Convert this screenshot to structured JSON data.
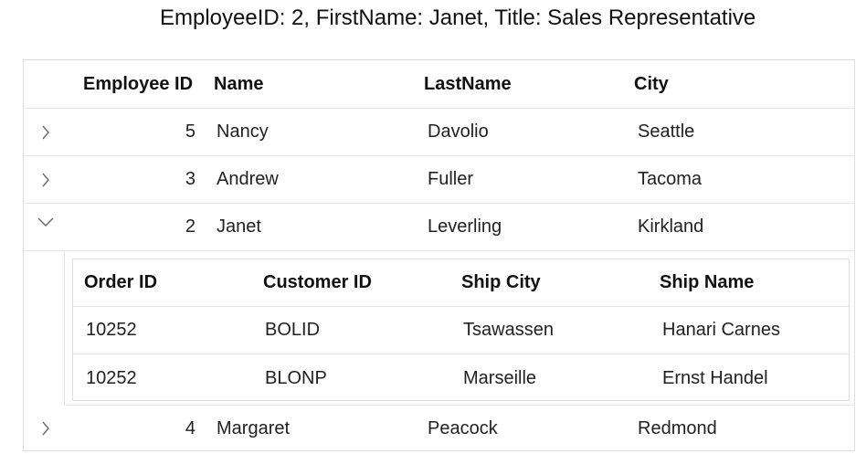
{
  "header": {
    "selected_text": "EmployeeID: 2, FirstName: Janet, Title: Sales Representative"
  },
  "grid": {
    "columns": [
      "Employee ID",
      "Name",
      "LastName",
      "City"
    ],
    "rows": [
      {
        "employee_id": "5",
        "name": "Nancy",
        "last_name": "Davolio",
        "city": "Seattle",
        "expanded": false
      },
      {
        "employee_id": "3",
        "name": "Andrew",
        "last_name": "Fuller",
        "city": "Tacoma",
        "expanded": false
      },
      {
        "employee_id": "2",
        "name": "Janet",
        "last_name": "Leverling",
        "city": "Kirkland",
        "expanded": true
      },
      {
        "employee_id": "4",
        "name": "Margaret",
        "last_name": "Peacock",
        "city": "Redmond",
        "expanded": false
      }
    ]
  },
  "child_grid": {
    "columns": [
      "Order ID",
      "Customer ID",
      "Ship City",
      "Ship Name"
    ],
    "rows": [
      {
        "order_id": "10252",
        "customer_id": "BOLID",
        "ship_city": "Tsawassen",
        "ship_name": "Hanari Carnes"
      },
      {
        "order_id": "10252",
        "customer_id": "BLONP",
        "ship_city": "Marseille",
        "ship_name": "Ernst Handel"
      }
    ]
  },
  "icons": {
    "collapsed": "chevron-right-icon",
    "expanded": "chevron-down-icon"
  }
}
